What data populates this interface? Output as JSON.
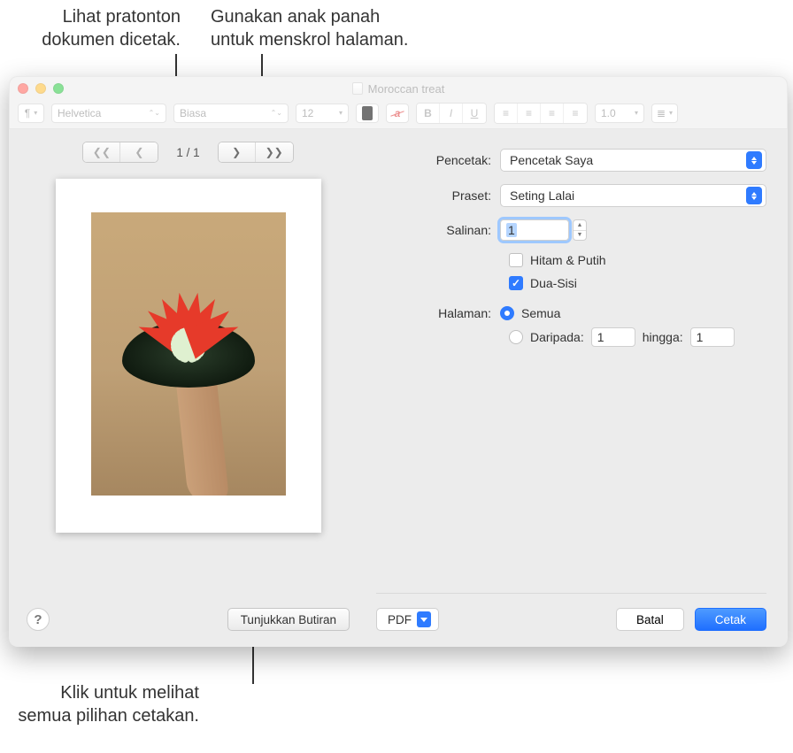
{
  "callouts": {
    "preview": "Lihat pratonton\ndokumen dicetak.",
    "arrows": "Gunakan anak panah\nuntuk menskrol halaman.",
    "details": "Klik untuk melihat\nsemua pilihan cetakan."
  },
  "window": {
    "title": "Moroccan treat"
  },
  "toolbar": {
    "paragraph": "¶",
    "font": "Helvetica",
    "style": "Biasa",
    "size": "12",
    "bold": "B",
    "italic": "I",
    "underline": "U",
    "spacing": "1.0"
  },
  "pager": {
    "count": "1 / 1"
  },
  "labels": {
    "printer": "Pencetak:",
    "preset": "Praset:",
    "copies": "Salinan:",
    "bw": "Hitam & Putih",
    "duplex": "Dua-Sisi",
    "pages": "Halaman:",
    "all": "Semua",
    "from": "Daripada:",
    "to": "hingga:"
  },
  "values": {
    "printer": "Pencetak Saya",
    "preset": "Seting Lalai",
    "copies": "1",
    "from": "1",
    "to": "1",
    "bw_checked": false,
    "duplex_checked": true,
    "pages_all_selected": true
  },
  "buttons": {
    "help": "?",
    "details": "Tunjukkan Butiran",
    "pdf": "PDF",
    "cancel": "Batal",
    "print": "Cetak"
  }
}
